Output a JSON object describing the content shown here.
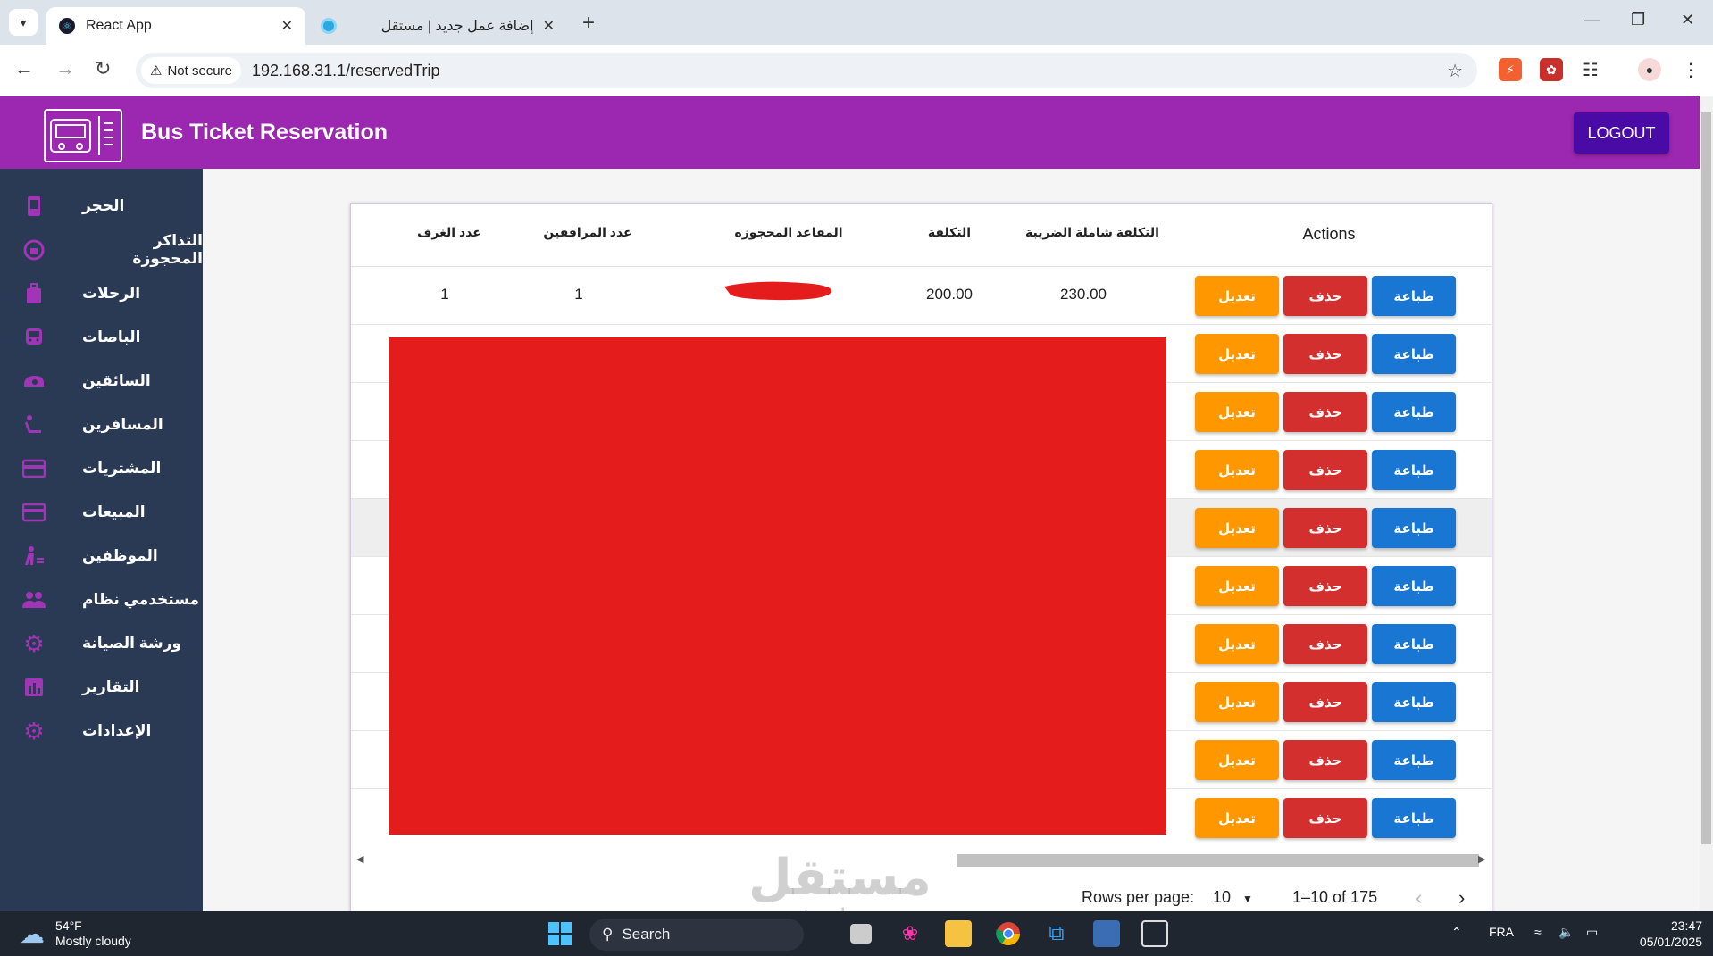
{
  "browser": {
    "tabs": [
      {
        "title": "React App",
        "active": true
      },
      {
        "title": "إضافة عمل جديد | مستقل",
        "active": false
      }
    ],
    "security_label": "Not secure",
    "url": "192.168.31.1/reservedTrip"
  },
  "app": {
    "title": "Bus Ticket Reservation",
    "logout_label": "LOGOUT",
    "accent": "#9c27b0"
  },
  "sidebar": {
    "items": [
      {
        "label": "الحجز",
        "icon": "phone-booking-icon"
      },
      {
        "label": "التذاكر المحجوزة",
        "icon": "ticket-lock-icon"
      },
      {
        "label": "الرحلات",
        "icon": "luggage-icon"
      },
      {
        "label": "الباصات",
        "icon": "bus-icon"
      },
      {
        "label": "السائقين",
        "icon": "steering-icon"
      },
      {
        "label": "المسافرين",
        "icon": "seat-passenger-icon"
      },
      {
        "label": "المشتريات",
        "icon": "credit-card-icon"
      },
      {
        "label": "المبيعات",
        "icon": "credit-card-icon"
      },
      {
        "label": "الموظفين",
        "icon": "employee-icon"
      },
      {
        "label": "مستخدمي نظام",
        "icon": "users-icon"
      },
      {
        "label": "ورشة الصيانة",
        "icon": "gear-icon"
      },
      {
        "label": "التقارير",
        "icon": "bar-chart-icon"
      },
      {
        "label": "الإعدادات",
        "icon": "gear-icon"
      }
    ]
  },
  "table": {
    "headers": {
      "rooms": "عدد الغرف",
      "companions": "عدد المرافقين",
      "reserved_seats": "المقاعد المحجوزه",
      "cost": "التكلفة",
      "cost_with_tax": "التكلفة شاملة الضريبة",
      "actions": "Actions"
    },
    "first_row": {
      "rooms": "1",
      "companions": "1",
      "cost": "200.00",
      "cost_with_tax": "230.00"
    },
    "buttons": {
      "edit": "تعديل",
      "delete": "حذف",
      "print": "طباعة"
    },
    "row_count": 10,
    "pagination": {
      "rows_per_page_label": "Rows per page:",
      "rows_per_page": "10",
      "range": "1–10 of 175"
    }
  },
  "watermark": {
    "text": "مستقل",
    "sub": "mostaql.com"
  },
  "taskbar": {
    "temperature": "54°F",
    "weather": "Mostly cloudy",
    "search_label": "Search",
    "language": "FRA",
    "time": "23:47",
    "date": "05/01/2025"
  }
}
